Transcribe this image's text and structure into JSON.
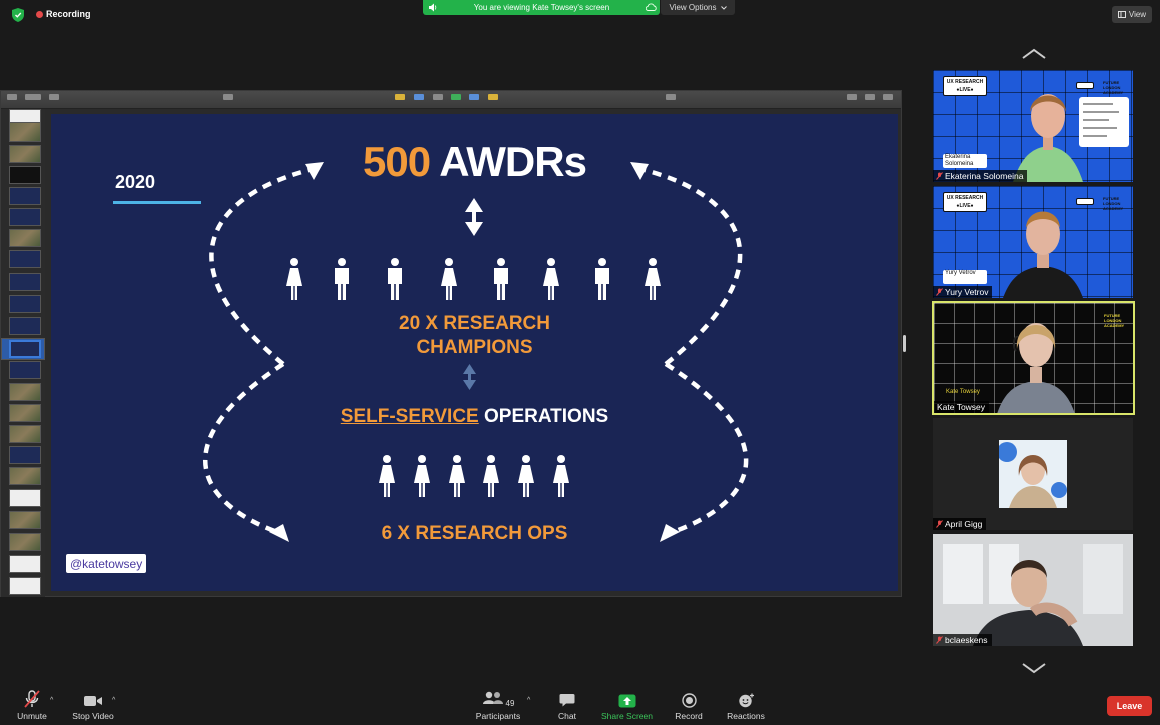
{
  "status": {
    "recording_label": "Recording",
    "viewing_banner": "You are viewing Kate Towsey's screen",
    "view_options_label": "View Options",
    "view_label": "View"
  },
  "slide": {
    "year": "2020",
    "title_number": "500",
    "title_word": "AWDRs",
    "champions_line1": "20 X RESEARCH",
    "champions_line2": "CHAMPIONS",
    "self_service_underlined": "SELF-SERVICE",
    "self_service_rest": " OPERATIONS",
    "ops_label": "6 X RESEARCH OPS",
    "handle": "@katetowsey",
    "colors": {
      "background": "#1a2555",
      "accent": "#f29a3a",
      "underline_bar": "#4db3e6"
    }
  },
  "participants": [
    {
      "name": "Ekaterina Solomeina",
      "muted": true,
      "plate": "Ekaterina Solomeina"
    },
    {
      "name": "Yury Vetrov",
      "muted": true,
      "plate": "Yury Vetrov"
    },
    {
      "name": "Kate Towsey",
      "muted": false,
      "active": true,
      "plate": "Kate Towsey"
    },
    {
      "name": "April Gigg",
      "muted": true
    },
    {
      "name": "bclaeskens",
      "muted": true
    }
  ],
  "tile_branding": {
    "ux_research_line1": "UX RESEARCH",
    "ux_research_line2": "●LIVE●",
    "future_logo": "FUTURE LONDON ACADEMY"
  },
  "toolbar": {
    "unmute_label": "Unmute",
    "stop_video_label": "Stop Video",
    "participants_label": "Participants",
    "participants_count": "49",
    "chat_label": "Chat",
    "share_screen_label": "Share Screen",
    "record_label": "Record",
    "reactions_label": "Reactions",
    "leave_label": "Leave"
  }
}
